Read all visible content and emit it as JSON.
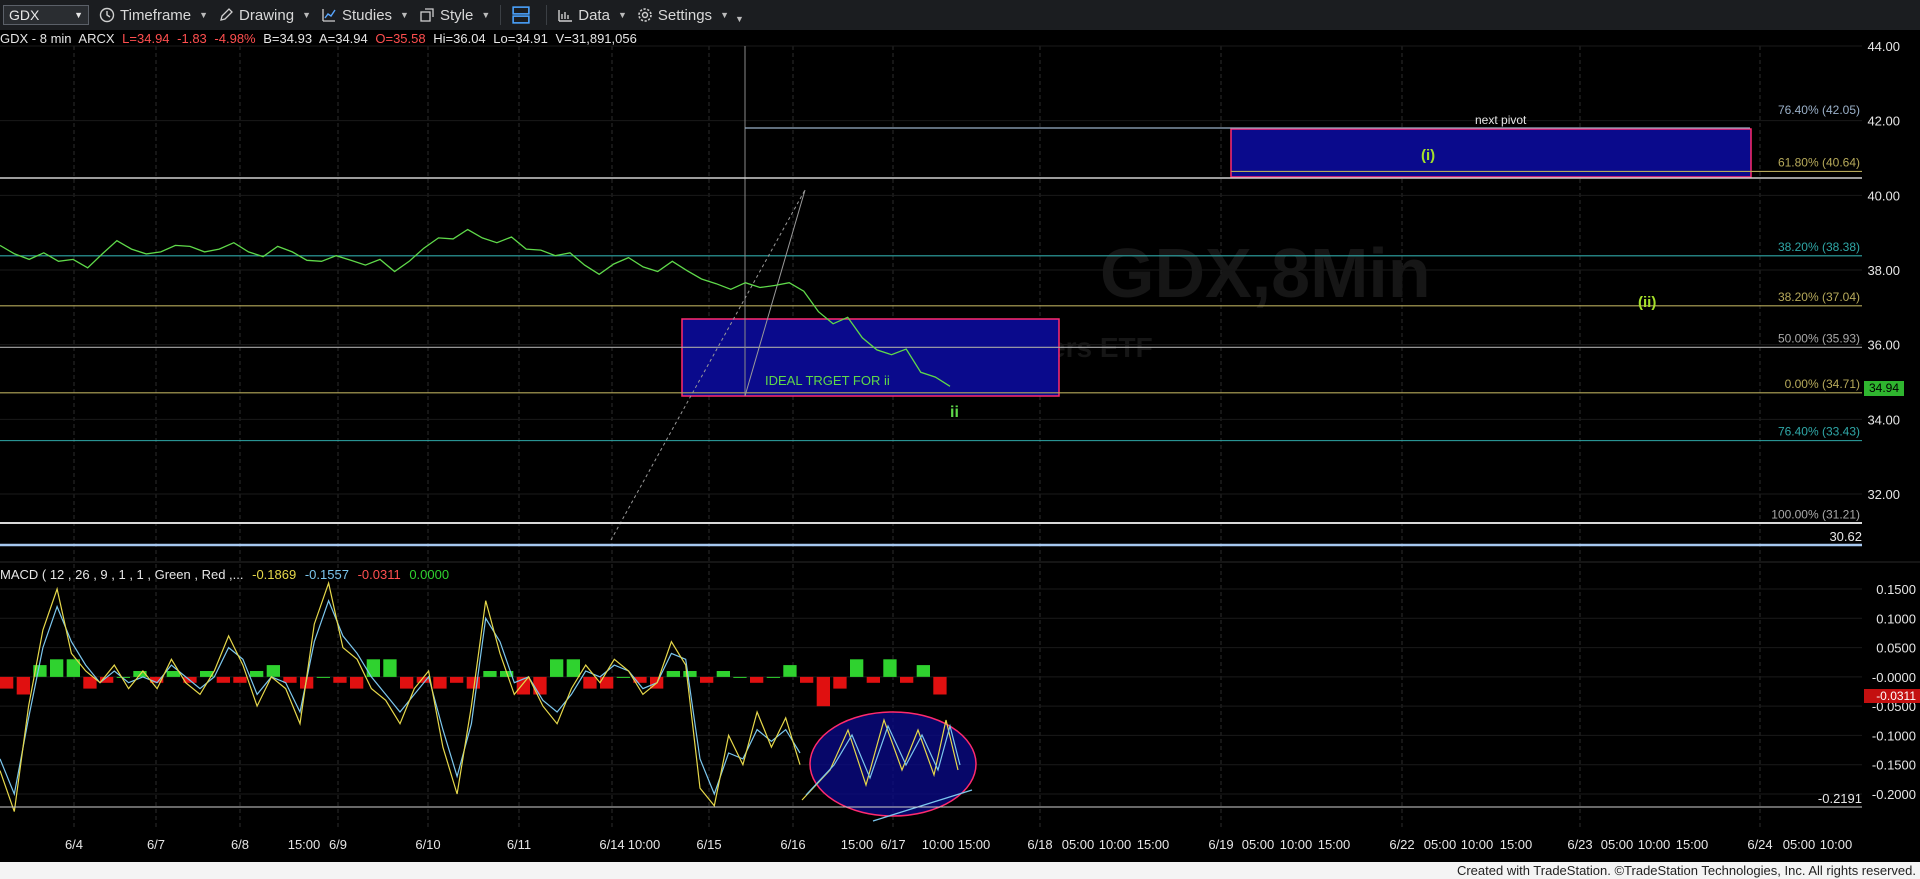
{
  "toolbar": {
    "symbol": "GDX",
    "timeframe_label": "Timeframe",
    "drawing_label": "Drawing",
    "studies_label": "Studies",
    "style_label": "Style",
    "data_label": "Data",
    "settings_label": "Settings"
  },
  "info": {
    "name": "GDX - 8 min",
    "exchange": "ARCX",
    "last": "L=34.94",
    "change": "-1.83",
    "pct": "-4.98%",
    "bid": "B=34.93",
    "ask": "A=34.94",
    "open": "O=35.58",
    "high": "Hi=36.04",
    "low": "Lo=34.91",
    "volume": "V=31,891,056"
  },
  "macd_info": {
    "label": "MACD ( 12 , 26 , 9 , 1 , 1 , Green , Red ,...",
    "v1": "-0.1869",
    "v2": "-0.1557",
    "v3": "-0.0311",
    "v4": "0.0000"
  },
  "colors": {
    "price_line": "#5fd94a",
    "fib_gold": "#b6a95a",
    "fib_teal": "#2fa7a7",
    "fib_gray": "#a8a8a8",
    "box_fill": "#0a0a8c",
    "box_border": "#ff2a6e",
    "macd_pos": "#2fd22f",
    "macd_neg": "#e01010",
    "macd_line": "#e6d84a",
    "signal_line": "#7cc7ee",
    "label_green": "#a5e02a"
  },
  "chart_data": {
    "type": "line",
    "title": "GDX,8Min",
    "price_axis": {
      "ylim": [
        29.9,
        44.4
      ],
      "ticks": [
        "44.00",
        "42.00",
        "40.00",
        "38.00",
        "36.00",
        "34.00",
        "32.00"
      ]
    },
    "last_price": "34.94",
    "price_level_marker": "30.62",
    "x_tick_labels": [
      "6/4",
      "6/7",
      "6/8",
      "15:00",
      "6/9",
      "6/10",
      "6/11",
      "6/14",
      "10:00",
      "6/15",
      "6/16",
      "15:00",
      "6/17",
      "10:00",
      "15:00",
      "6/18",
      "05:00",
      "10:00",
      "15:00",
      "6/19",
      "05:00",
      "10:00",
      "15:00",
      "6/22",
      "05:00",
      "10:00",
      "15:00",
      "6/23",
      "05:00",
      "10:00",
      "15:00",
      "6/24",
      "05:00",
      "10:00"
    ],
    "price_series": {
      "name": "GDX",
      "values": [
        38.7,
        38.4,
        38.3,
        38.5,
        38.2,
        38.3,
        38.1,
        38.4,
        38.8,
        38.6,
        38.4,
        38.5,
        38.7,
        38.6,
        38.5,
        38.6,
        38.7,
        38.5,
        38.4,
        38.6,
        38.5,
        38.3,
        38.2,
        38.4,
        38.3,
        38.1,
        38.3,
        38.0,
        38.2,
        38.6,
        38.9,
        38.8,
        39.1,
        38.9,
        38.7,
        38.9,
        38.6,
        38.5,
        38.4,
        38.5,
        38.1,
        37.9,
        38.2,
        38.3,
        38.1,
        38.0,
        38.2,
        38.0,
        37.8,
        37.6,
        37.5,
        37.7,
        37.5,
        37.6,
        37.7,
        37.4,
        36.9,
        36.6,
        36.7,
        36.2,
        35.9,
        35.7,
        35.9,
        35.3,
        35.1,
        34.9
      ]
    },
    "fib_levels": [
      {
        "label": "76.40% (42.05)",
        "value": 42.05
      },
      {
        "label": "61.80% (40.64)",
        "value": 40.64
      },
      {
        "label": "38.20% (38.38)",
        "value": 38.38
      },
      {
        "label": "38.20% (37.04)",
        "value": 37.04
      },
      {
        "label": "50.00% (35.93)",
        "value": 35.93
      },
      {
        "label": "0.00% (34.71)",
        "value": 34.71
      },
      {
        "label": "76.40% (33.43)",
        "value": 33.43
      },
      {
        "label": "100.00% (31.21)",
        "value": 31.21
      }
    ],
    "annotations": {
      "next_pivot": "next pivot",
      "wave_i": "(i)",
      "wave_ii": "(ii)",
      "small_ii": "ii",
      "target_text": "IDEAL TRGET FOR ii",
      "watermark_sub": "ers ETF"
    },
    "boxes": [
      {
        "name": "next-pivot-box",
        "y_top": 42.0,
        "y_bottom": 40.64
      },
      {
        "name": "target-box",
        "y_top": 36.8,
        "y_bottom": 34.6
      }
    ],
    "macd": {
      "axis_ticks": [
        "0.1500",
        "0.1000",
        "0.0500",
        "-0.0000",
        "-0.0500",
        "-0.1000",
        "-0.1500",
        "-0.2000"
      ],
      "ylim": [
        -0.245,
        0.175
      ],
      "current_hist": "-0.0311",
      "min_marker": "-0.2191",
      "macd_values": [
        -0.16,
        -0.23,
        -0.05,
        0.08,
        0.15,
        0.04,
        0.01,
        -0.01,
        0.02,
        -0.02,
        0.01,
        -0.02,
        0.03,
        -0.01,
        -0.03,
        0.01,
        0.07,
        0.02,
        -0.05,
        0.0,
        -0.02,
        -0.08,
        0.09,
        0.16,
        0.05,
        0.03,
        -0.02,
        -0.04,
        -0.08,
        -0.02,
        0.01,
        -0.12,
        -0.2,
        -0.05,
        0.13,
        0.04,
        -0.03,
        0.0,
        -0.05,
        -0.08,
        -0.02,
        0.02,
        -0.01,
        0.03,
        0.01,
        -0.03,
        -0.01,
        0.06,
        0.02,
        -0.19,
        -0.22,
        -0.1,
        -0.15,
        -0.06,
        -0.12,
        -0.07,
        -0.15
      ],
      "signal_values": [
        -0.14,
        -0.2,
        -0.07,
        0.05,
        0.12,
        0.06,
        0.02,
        -0.01,
        0.01,
        -0.01,
        0.0,
        -0.01,
        0.02,
        0.0,
        -0.02,
        0.0,
        0.05,
        0.03,
        -0.03,
        0.0,
        -0.01,
        -0.06,
        0.06,
        0.13,
        0.07,
        0.04,
        0.0,
        -0.03,
        -0.06,
        -0.03,
        0.0,
        -0.09,
        -0.17,
        -0.08,
        0.1,
        0.06,
        -0.01,
        0.0,
        -0.04,
        -0.06,
        -0.03,
        0.01,
        0.0,
        0.02,
        0.01,
        -0.02,
        -0.01,
        0.04,
        0.03,
        -0.14,
        -0.2,
        -0.13,
        -0.14,
        -0.09,
        -0.11,
        -0.09,
        -0.13
      ],
      "hist_values": [
        -0.02,
        -0.03,
        0.02,
        0.03,
        0.03,
        -0.02,
        -0.01,
        0.0,
        0.01,
        -0.01,
        0.01,
        -0.01,
        0.01,
        -0.01,
        -0.01,
        0.01,
        0.02,
        -0.01,
        -0.02,
        0.0,
        -0.01,
        -0.02,
        0.03,
        0.03,
        -0.02,
        -0.01,
        -0.02,
        -0.01,
        -0.02,
        0.01,
        0.01,
        -0.03,
        -0.03,
        0.03,
        0.03,
        -0.02,
        -0.02,
        0.0,
        -0.01,
        -0.02,
        0.01,
        0.01,
        -0.01,
        0.01,
        0.0,
        -0.01,
        0.0,
        0.02,
        -0.01,
        -0.05,
        -0.02,
        0.03,
        -0.01,
        0.03,
        -0.01,
        0.02,
        -0.03
      ]
    }
  },
  "footer_text": "Created with TradeStation. ©TradeStation Technologies, Inc. All rights reserved."
}
